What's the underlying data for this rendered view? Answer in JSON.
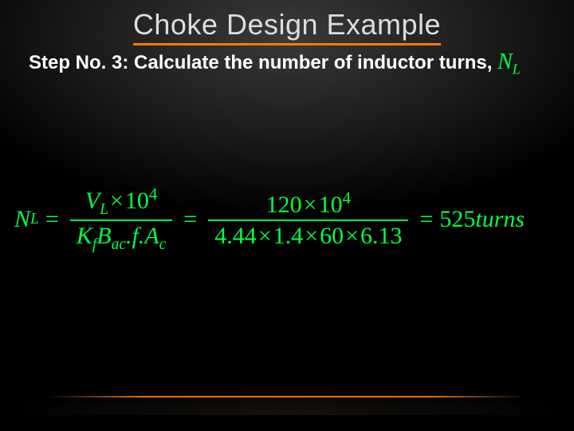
{
  "title": "Choke Design Example",
  "step": {
    "prefix": "Step No. 3: Calculate the number of inductor turns,",
    "symbol_main": "N",
    "symbol_sub": "L"
  },
  "equation": {
    "lhs_main": "N",
    "lhs_sub": "L",
    "eq": "=",
    "frac1": {
      "num_V": "V",
      "num_Lsub": "L",
      "num_times": "×",
      "num_ten": "10",
      "num_exp": "4",
      "den_K": "K",
      "den_fsub": "f",
      "den_B": "B",
      "den_acsub": "ac",
      "den_dotf": ".f.",
      "den_A": "A",
      "den_csub": "c"
    },
    "frac2": {
      "num_120": "120",
      "num_times": "×",
      "num_ten": "10",
      "num_exp": "4",
      "den_444": "4.44",
      "den_t1": "×",
      "den_14": "1.4",
      "den_t2": "×",
      "den_60": "60",
      "den_t3": "×",
      "den_613": "6.13"
    },
    "result_val": "525",
    "result_unit": "turns"
  }
}
